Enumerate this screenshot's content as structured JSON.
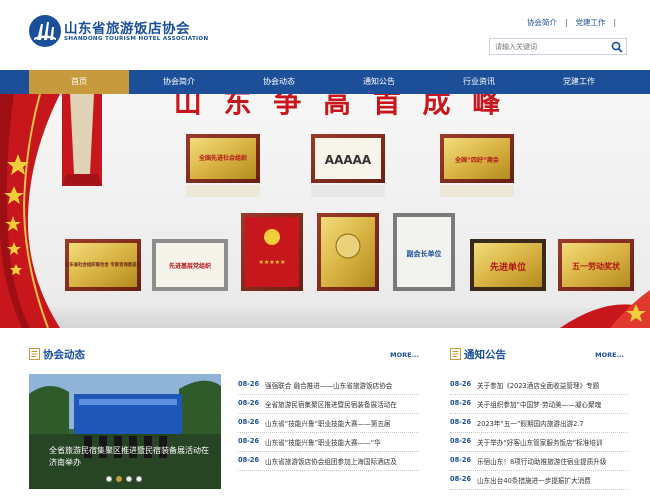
{
  "header": {
    "logo_cn": "山东省旅游饭店协会",
    "logo_en": "SHANDONG  TOURISM HOTEL ASSOCIATION",
    "top_links": [
      "协会简介",
      "党建工作"
    ],
    "search_placeholder": "请输入关键词"
  },
  "nav": {
    "items": [
      "首页",
      "协会简介",
      "协会动态",
      "通知公告",
      "行业资讯",
      "党建工作"
    ],
    "active_index": 0
  },
  "banner": {
    "slogan": "山 东 争 高 首 成 峰",
    "plaques": [
      "全国先进社会组织",
      "AAAAA",
      "全国“四好”商会",
      "山东省社会组织联合会 专家咨询委员会",
      "先进基层党组织",
      "★★★★★",
      "副会长单位",
      "先进单位",
      "五一劳动奖状"
    ],
    "colors": {
      "red": "#c8161d",
      "gold": "#c9a227",
      "wall": "#f3f3f3"
    }
  },
  "sections": {
    "news": {
      "title": "协会动态",
      "more": "MORE...",
      "photo_caption": "全省旅游民宿集聚区推进暨民宿装备展活动在济南举办",
      "items": [
        {
          "date": "08-26",
          "title": "强强联合 融合推进——山东省旅游饭店协会"
        },
        {
          "date": "08-26",
          "title": "全省旅游民宿集聚区推进暨民宿装备展活动在"
        },
        {
          "date": "08-26",
          "title": "山东省“技能兴鲁”职业技能大赛——第五届"
        },
        {
          "date": "08-26",
          "title": "山东省“技能兴鲁”职业技能大赛——“华"
        },
        {
          "date": "08-26",
          "title": "山东省旅游饭店协会组团参加上海国际酒店及"
        }
      ]
    },
    "notices": {
      "title": "通知公告",
      "more": "MORE...",
      "items": [
        {
          "date": "08-26",
          "title": "关于参加《2023酒店全面收益管理》专题"
        },
        {
          "date": "08-26",
          "title": "关于组织参加“中国梦·劳动美——凝心聚魂"
        },
        {
          "date": "08-26",
          "title": "2023年“五一”假期国内旅游出游2.7"
        },
        {
          "date": "08-26",
          "title": "关于举办“好客山东管家服务饭店”标准培训"
        },
        {
          "date": "08-26",
          "title": "乐宿山东！8项行动助推旅游住宿业提质升级"
        },
        {
          "date": "08-26",
          "title": "山东出台40条措施进一步提振扩大消费"
        }
      ]
    }
  }
}
